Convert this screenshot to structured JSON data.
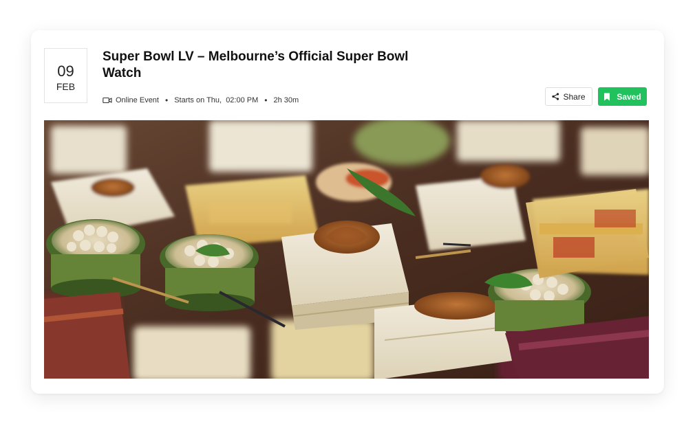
{
  "event": {
    "date": {
      "day": "09",
      "month": "FEB"
    },
    "title": "Super Bowl LV – Melbourne’s Official Super Bowl Watch",
    "meta": {
      "type_icon": "video-camera-icon",
      "type": "Online Event",
      "starts": "Starts on Thu,  02:00 PM",
      "duration": "2h 30m"
    }
  },
  "actions": {
    "share_label": "Share",
    "share_icon": "share-icon",
    "saved_label": "Saved",
    "saved_icon": "bookmark-icon",
    "saved_color": "#21c25e"
  },
  "hero": {
    "subject": "canapés photo"
  }
}
